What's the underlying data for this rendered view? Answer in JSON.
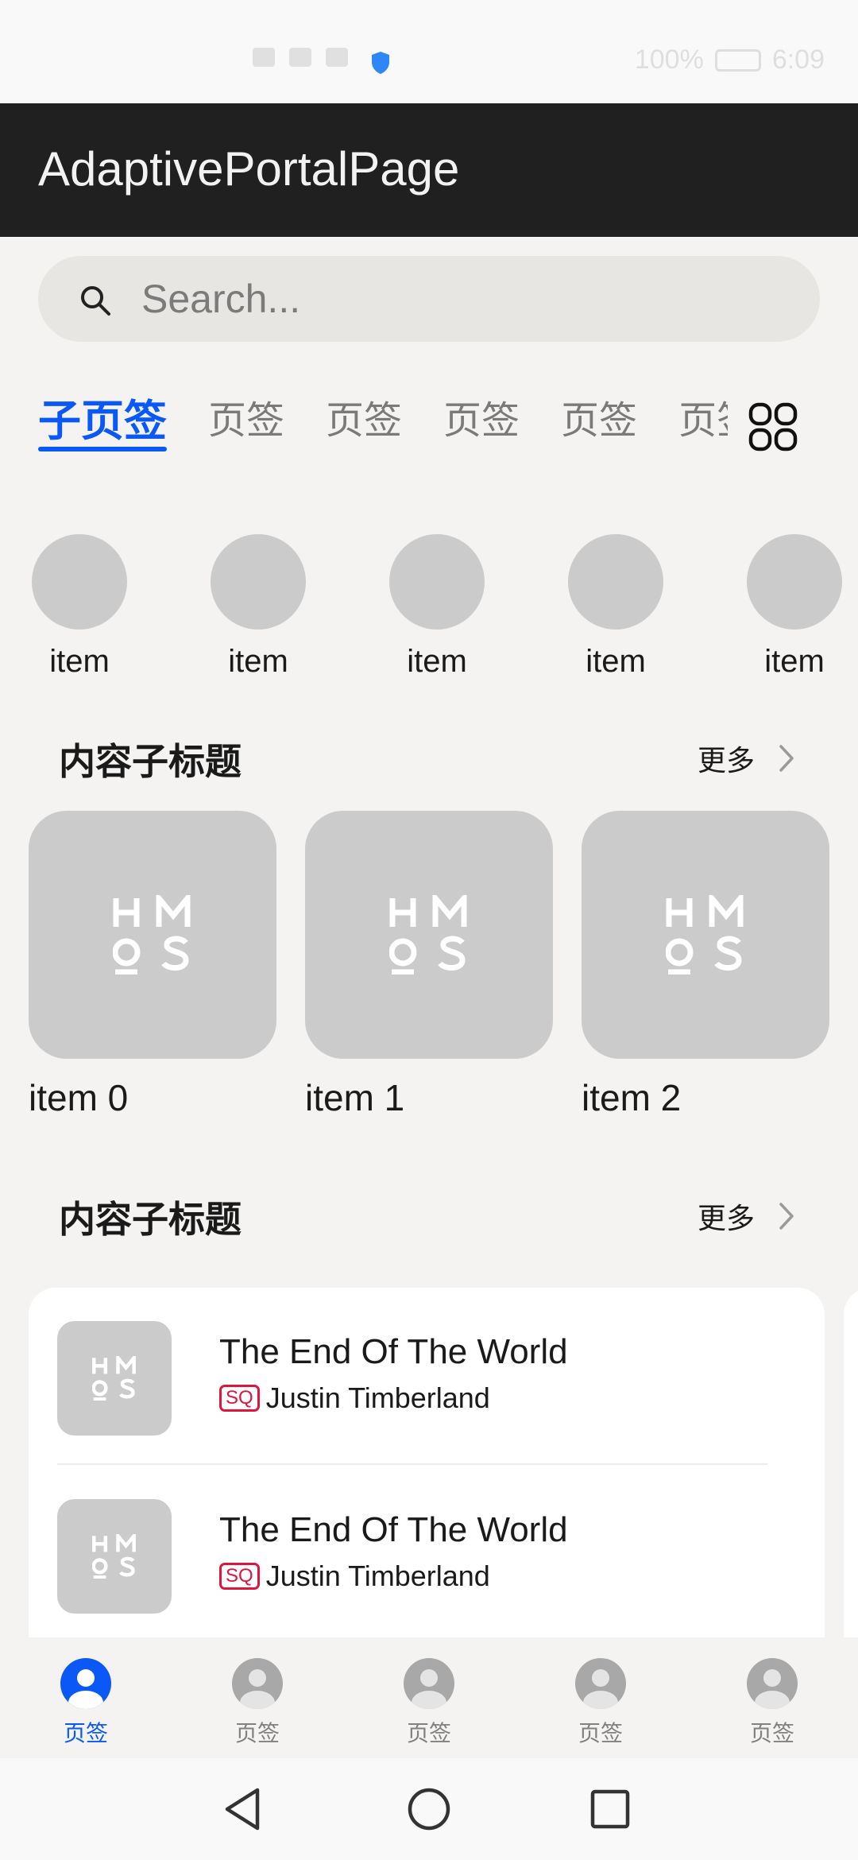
{
  "status_bar": {
    "battery": "100%",
    "time": "6:09"
  },
  "app_bar": {
    "title": "AdaptivePortalPage"
  },
  "search": {
    "placeholder": "Search..."
  },
  "tabs": [
    {
      "label": "子页签",
      "active": true
    },
    {
      "label": "页签"
    },
    {
      "label": "页签"
    },
    {
      "label": "页签"
    },
    {
      "label": "页签"
    },
    {
      "label": "页签"
    }
  ],
  "circle_items": [
    "item",
    "item",
    "item",
    "item",
    "item"
  ],
  "section1": {
    "title": "内容子标题",
    "more": "更多"
  },
  "cards": [
    "item 0",
    "item 1",
    "item 2"
  ],
  "section2": {
    "title": "内容子标题",
    "more": "更多"
  },
  "songs": [
    {
      "title": "The End Of The World",
      "badge": "SQ",
      "artist": "Justin Timberland"
    },
    {
      "title": "The End Of The World",
      "badge": "SQ",
      "artist": "Justin Timberland"
    }
  ],
  "bottom_nav": [
    {
      "label": "页签",
      "active": true
    },
    {
      "label": "页签"
    },
    {
      "label": "页签"
    },
    {
      "label": "页签"
    },
    {
      "label": "页签"
    }
  ],
  "colors": {
    "accent": "#0a59f7",
    "app_bar": "#202020",
    "placeholder": "#cbcbcb",
    "badge": "#e1143c"
  },
  "icons": {
    "search": "search-icon",
    "grid": "grid-icon",
    "more": "chevron-right-icon",
    "nav": "person-icon"
  }
}
